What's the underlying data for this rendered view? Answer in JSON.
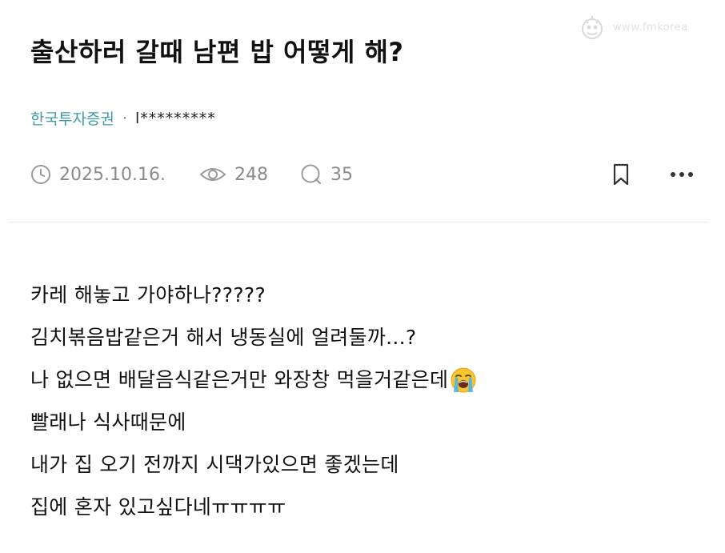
{
  "watermark": {
    "text": "www.fmkorea"
  },
  "post": {
    "title": "출산하러 갈때 남편 밥 어떻게 해?",
    "company": "한국투자증권",
    "separator": "·",
    "author": "l*********",
    "date": "2025.10.16.",
    "views": "248",
    "comments": "35",
    "icons": {
      "date": "clock-icon",
      "views": "eye-icon",
      "comments": "comment-bubble-icon",
      "bookmark": "bookmark-icon",
      "more": "more-dots-icon"
    },
    "body_lines": [
      "카레 해놓고 가야하나?????",
      "김치볶음밥같은거 해서 냉동실에 얼려둘까...?",
      "나 없으면 배달음식같은거만 와장창 먹을거같은데",
      "빨래나 식사때문에",
      "내가 집 오기 전까지 시댁가있으면 좋겠는데",
      "집에 혼자 있고싶다네ㅠㅠㅠㅠ"
    ],
    "emoji_name": "loudly-crying-face-emoji"
  },
  "colors": {
    "company": "#3d9aa8",
    "meta": "#8a8a8a",
    "title": "#111111",
    "divider": "#ececec"
  }
}
